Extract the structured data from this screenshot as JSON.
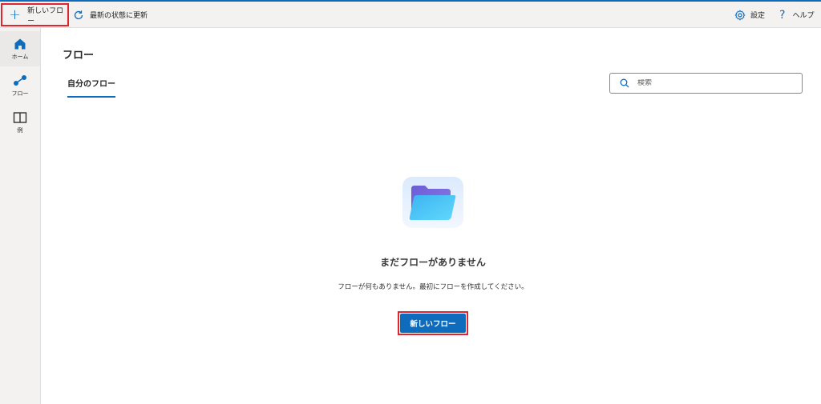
{
  "toolbar": {
    "new_flow_label": "新しいフロー",
    "refresh_label": "最新の状態に更新",
    "settings_label": "設定",
    "help_label": "ヘルプ"
  },
  "sidebar": {
    "items": [
      {
        "label": "ホーム",
        "icon": "home-icon",
        "active": true
      },
      {
        "label": "フロー",
        "icon": "flow-icon",
        "active": false
      },
      {
        "label": "例",
        "icon": "book-icon",
        "active": false
      }
    ]
  },
  "main": {
    "title": "フロー",
    "tabs": [
      {
        "label": "自分のフロー",
        "selected": true
      }
    ],
    "search": {
      "placeholder": "検索",
      "value": ""
    },
    "empty_state": {
      "icon": "folder-icon",
      "title": "まだフローがありません",
      "description": "フローが何もありません。最初にフローを作成してください。",
      "button_label": "新しいフロー"
    }
  },
  "colors": {
    "accent": "#0f6cbd",
    "highlight": "#e0252e",
    "toolbar_bg": "#f3f2f1"
  }
}
